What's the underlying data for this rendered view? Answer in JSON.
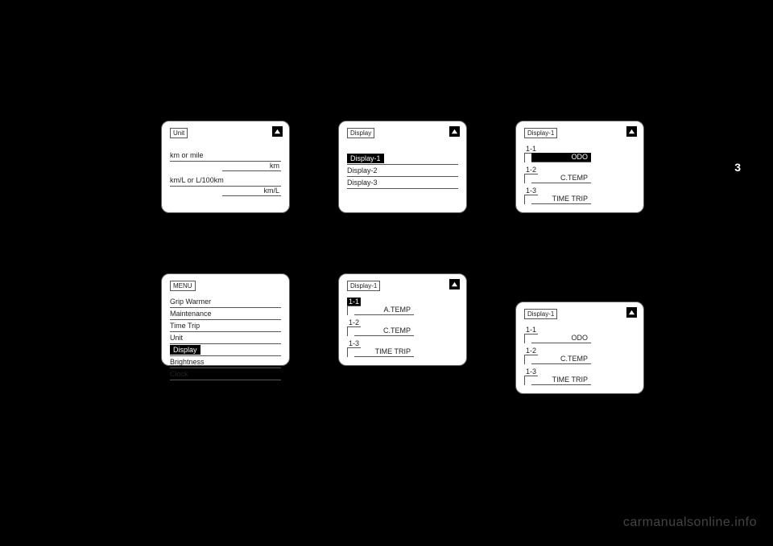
{
  "page_number": "3",
  "watermark": "carmanualsonline.info",
  "panels": {
    "unit": {
      "tag": "Unit",
      "row1": "km or mile",
      "row1_sub": "km",
      "row2": "km/L or L/100km",
      "row2_sub": "km/L"
    },
    "display": {
      "tag": "Display",
      "opt1": "Display-1",
      "opt2": "Display-2",
      "opt3": "Display-3"
    },
    "display1a": {
      "tag": "Display-1",
      "s1_label": "1-1",
      "s1_value": "ODO",
      "s2_label": "1-2",
      "s2_value": "C.TEMP",
      "s3_label": "1-3",
      "s3_value": "TIME TRIP"
    },
    "menu": {
      "tag": "MENU",
      "i1": "Grip Warmer",
      "i2": "Maintenance",
      "i3": "Time Trip",
      "i4": "Unit",
      "i5": "Display",
      "i6": "Brightness",
      "i7": "Clock"
    },
    "display1b": {
      "tag": "Display-1",
      "s1_label": "1-1",
      "s1_value": "A.TEMP",
      "s2_label": "1-2",
      "s2_value": "C.TEMP",
      "s3_label": "1-3",
      "s3_value": "TIME TRIP"
    },
    "display1c": {
      "tag": "Display-1",
      "s1_label": "1-1",
      "s1_value": "ODO",
      "s2_label": "1-2",
      "s2_value": "C.TEMP",
      "s3_label": "1-3",
      "s3_value": "TIME TRIP"
    }
  }
}
